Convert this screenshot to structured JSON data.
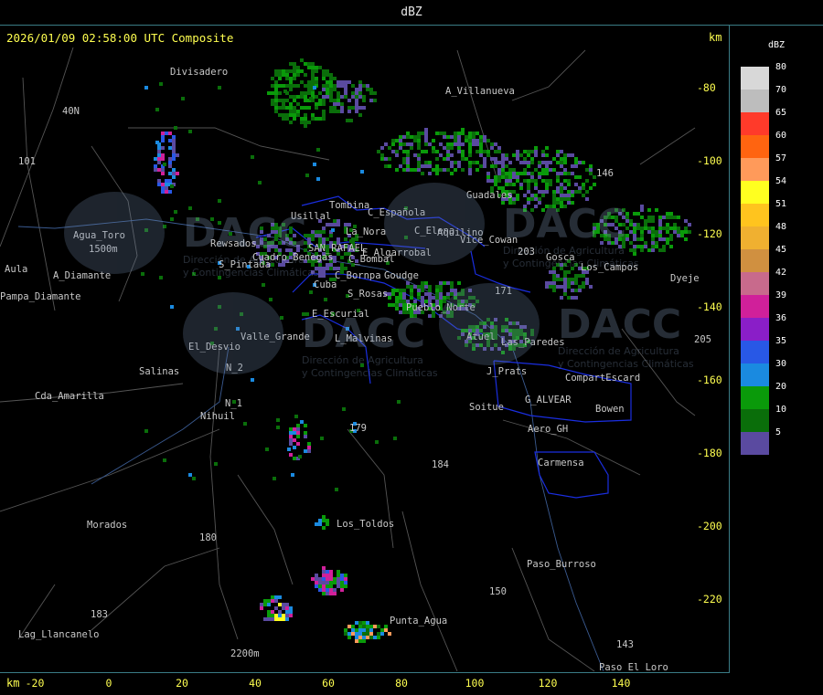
{
  "window": {
    "title": "dBZ"
  },
  "header": {
    "timestamp": "2026/01/09 02:58:00 UTC Composite",
    "units_top": "km",
    "units_bottom": "km"
  },
  "axes": {
    "x_ticks": [
      "-20",
      "0",
      "20",
      "40",
      "60",
      "80",
      "100",
      "120",
      "140"
    ],
    "y_ticks": [
      "-80",
      "-100",
      "-120",
      "-140",
      "-160",
      "-180",
      "-200",
      "-220"
    ]
  },
  "legend": {
    "title": "dBZ",
    "entries": [
      {
        "label": "80",
        "color": "#d8d8d8"
      },
      {
        "label": "70",
        "color": "#bdbdbd"
      },
      {
        "label": "65",
        "color": "#ff3a2a"
      },
      {
        "label": "60",
        "color": "#ff6410"
      },
      {
        "label": "57",
        "color": "#ff9a5a"
      },
      {
        "label": "54",
        "color": "#ffff20"
      },
      {
        "label": "51",
        "color": "#ffc41e"
      },
      {
        "label": "48",
        "color": "#f0b030"
      },
      {
        "label": "45",
        "color": "#d09040"
      },
      {
        "label": "42",
        "color": "#c86a8c"
      },
      {
        "label": "39",
        "color": "#d0209a"
      },
      {
        "label": "36",
        "color": "#8a1ec8"
      },
      {
        "label": "35",
        "color": "#2858e6"
      },
      {
        "label": "30",
        "color": "#1a8ae0"
      },
      {
        "label": "20",
        "color": "#0a9a0a"
      },
      {
        "label": "10",
        "color": "#0a6e0a"
      },
      {
        "label": "5",
        "color": "#5a4aa0"
      }
    ]
  },
  "map_labels": [
    "Divisadero",
    "A_Villanueva",
    "40N",
    "101",
    "Guadales",
    "146",
    "Usillal",
    "Tombina",
    "C_Española",
    "C_Elena",
    "Aquilino",
    "Agua_Toro",
    "1500m",
    "Rewsados",
    "La_Nora",
    "Vice_Cowan",
    "Gosca",
    "Los_Campos",
    "Dyeje",
    "Aula",
    "A_Diamante",
    "C_Bombal",
    "SAN_RAFAEL",
    "E_Algarrobal",
    "Pampa_Diamante",
    "S_Pintada",
    "Cuadro_Benegas",
    "C_Bornpa",
    "Goudge",
    "Cuba",
    "S_Rosas",
    "Pueblo_Norte",
    "E_Escurial",
    "Valle_Grande",
    "L_Malvinas",
    "El_Desvio",
    "Atuel",
    "Las_Paredes",
    "Salinas",
    "N_2",
    "J_Prats",
    "CompartEscard",
    "Cda_Amarilla",
    "N_1",
    "G_ALVEAR",
    "Soitue",
    "Bowen",
    "Nihuil",
    "Aero_GH",
    "Carmensa",
    "179",
    "184",
    "Morados",
    "Los_Toldos",
    "180",
    "Paso_Burroso",
    "Punta_Agua",
    "Lag_Llancanelo",
    "2200m",
    "Paso_El_Loro",
    "171",
    "203",
    "205",
    "183",
    "143",
    "150"
  ],
  "watermark": {
    "brand": "DACC",
    "subtitle_1": "Dirección de Agricultura",
    "subtitle_2": "y Contingencias Climáticas"
  }
}
